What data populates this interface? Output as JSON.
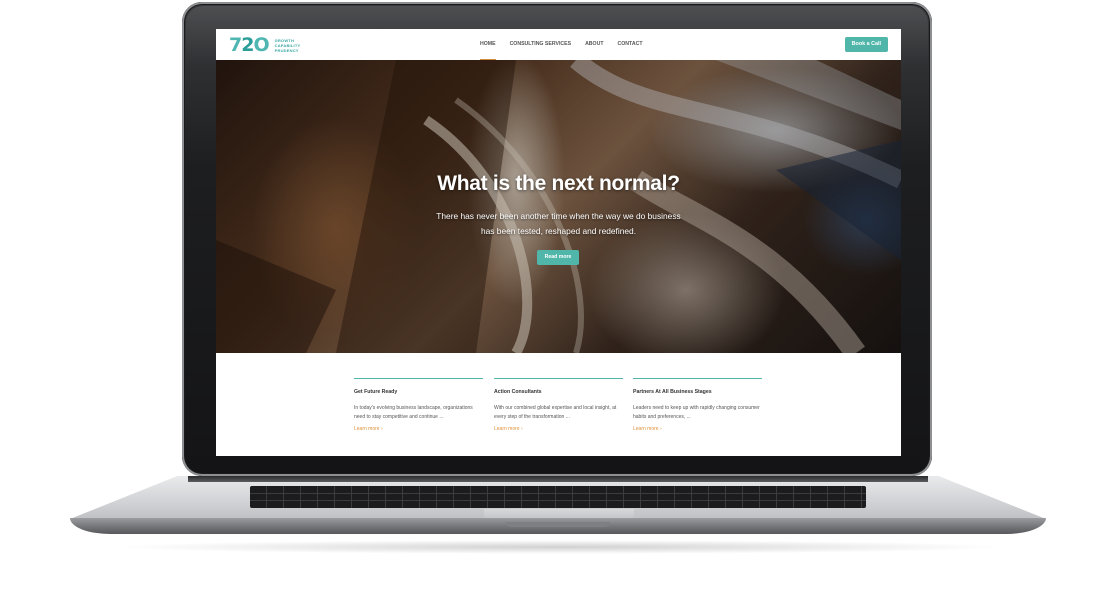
{
  "logo": {
    "mark_parts": [
      "7",
      "2",
      "O"
    ],
    "lines": [
      "GROWTH",
      "CAPABILITY",
      "PRUDENCY"
    ]
  },
  "nav": {
    "items": [
      {
        "label": "HOME",
        "active": true
      },
      {
        "label": "CONSULTING SERVICES",
        "active": false
      },
      {
        "label": "ABOUT",
        "active": false
      },
      {
        "label": "CONTACT",
        "active": false
      }
    ],
    "cta_label": "Book a Call"
  },
  "hero": {
    "title": "What is the next normal?",
    "subtitle_line1": "There has never been another time when the way we do business",
    "subtitle_line2": "has been tested, reshaped and redefined.",
    "button_label": "Read more"
  },
  "features": [
    {
      "title": "Get Future Ready",
      "text": "In today's evolving business landscape, organizations need to stay competitive and continue ...",
      "link": "Learn more ›"
    },
    {
      "title": "Action Consultants",
      "text": "With our combined global expertise and local insight, at every step of the transformation ...",
      "link": "Learn more ›"
    },
    {
      "title": "Partners At All Business Stages",
      "text": "Leaders need to keep up with rapidly changing consumer habits and preferences, ...",
      "link": "Learn more ›"
    }
  ],
  "colors": {
    "accent": "#4fb6a9",
    "link": "#e0913c",
    "nav_active_underline": "#d48a3a"
  }
}
